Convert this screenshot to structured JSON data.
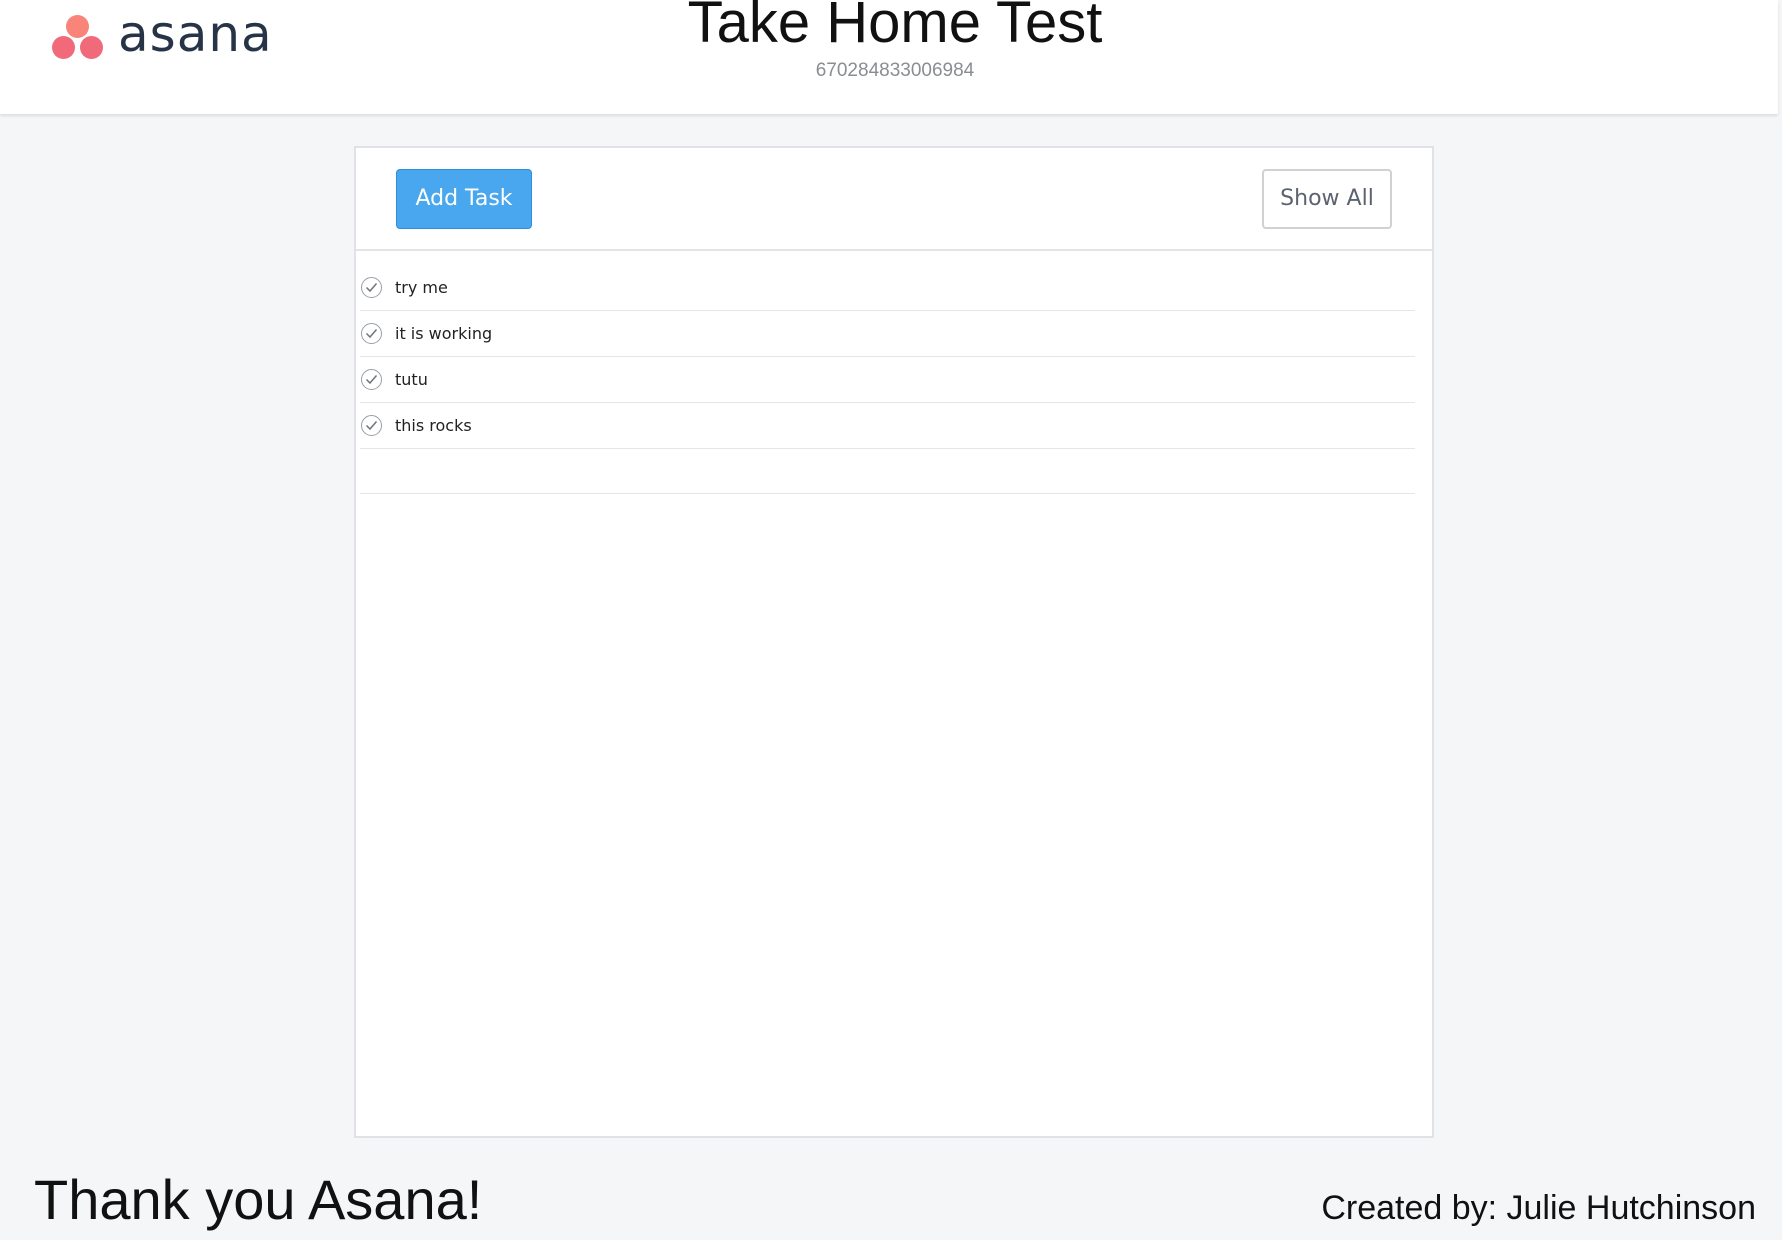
{
  "header": {
    "logo_text": "asana",
    "title": "Take Home Test",
    "project_id": "670284833006984"
  },
  "toolbar": {
    "add_task_label": "Add Task",
    "show_all_label": "Show All"
  },
  "tasks": [
    {
      "name": "try me",
      "icon": "checkmark-circle-icon"
    },
    {
      "name": "it is working",
      "icon": "checkmark-circle-icon"
    },
    {
      "name": "tutu",
      "icon": "checkmark-circle-icon"
    },
    {
      "name": "this rocks",
      "icon": "checkmark-circle-icon"
    }
  ],
  "footer": {
    "thanks": "Thank you Asana!",
    "credit": "Created by: Julie Hutchinson"
  },
  "colors": {
    "accent": "#48a7ee",
    "logo_coral": "#f06a7a",
    "logo_text": "#273347",
    "background": "#f5f6f8"
  }
}
